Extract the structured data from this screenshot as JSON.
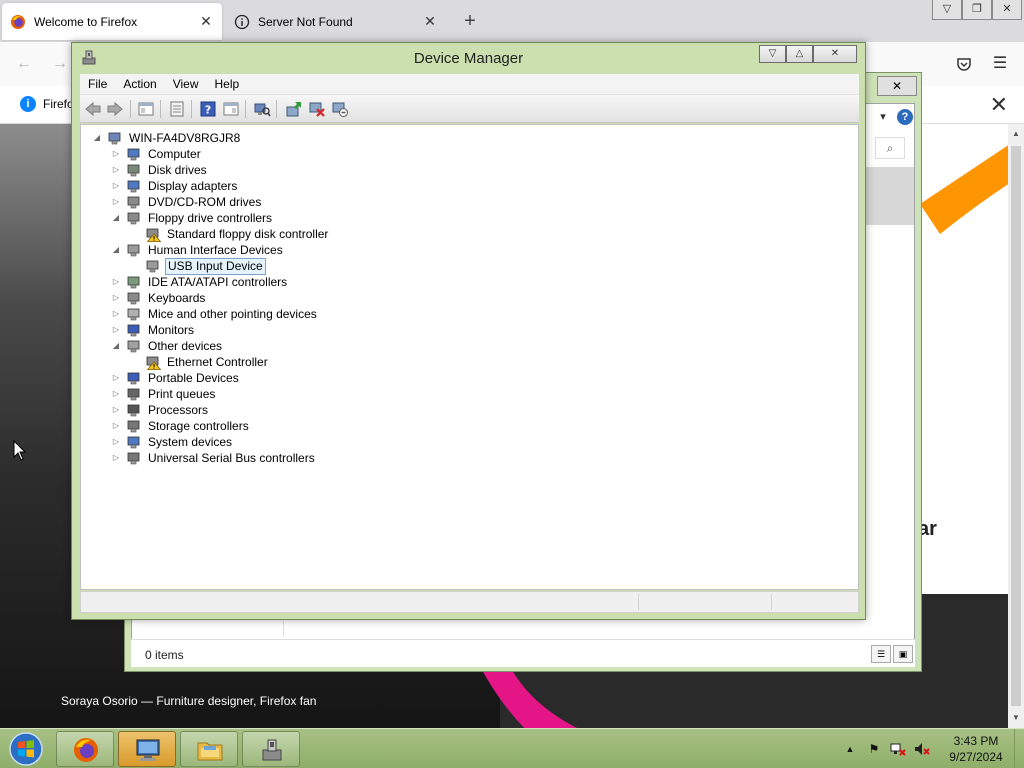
{
  "browser": {
    "tabs": [
      {
        "title": "Welcome to Firefox",
        "active": true,
        "icon": "firefox-icon"
      },
      {
        "title": "Server Not Found",
        "active": false,
        "icon": "info-circle-icon"
      }
    ],
    "notification": {
      "text": "Firefo",
      "icon": "info-icon"
    },
    "page": {
      "heading_fragment": "ar",
      "credit": "Soraya Osorio — Furniture designer, Firefox fan"
    },
    "accent_colors": {
      "tab_bar": "#dbdbde",
      "orange": "#ff9500",
      "pink": "#e31587"
    }
  },
  "background_window": {
    "status_text": "0 items"
  },
  "device_manager": {
    "title": "Device Manager",
    "menu": [
      "File",
      "Action",
      "View",
      "Help"
    ],
    "toolbar": [
      "back-icon",
      "forward-icon",
      "show-hide-console-tree-icon",
      "properties-icon",
      "help-icon",
      "action-pane-icon",
      "scan-hardware-icon",
      "update-driver-icon",
      "disable-device-icon",
      "uninstall-device-icon"
    ],
    "tree": [
      {
        "label": "WIN-FA4DV8RGJR8",
        "level": 0,
        "expanded": true,
        "icon": "computer-root-icon"
      },
      {
        "label": "Computer",
        "level": 1,
        "expanded": false,
        "icon": "computer-icon"
      },
      {
        "label": "Disk drives",
        "level": 1,
        "expanded": false,
        "icon": "disk-drive-icon"
      },
      {
        "label": "Display adapters",
        "level": 1,
        "expanded": false,
        "icon": "display-adapter-icon"
      },
      {
        "label": "DVD/CD-ROM drives",
        "level": 1,
        "expanded": false,
        "icon": "dvd-drive-icon"
      },
      {
        "label": "Floppy drive controllers",
        "level": 1,
        "expanded": true,
        "icon": "floppy-controller-icon"
      },
      {
        "label": "Standard floppy disk controller",
        "level": 2,
        "icon": "warning-device-icon"
      },
      {
        "label": "Human Interface Devices",
        "level": 1,
        "expanded": true,
        "icon": "hid-icon"
      },
      {
        "label": "USB Input Device",
        "level": 2,
        "selected": true,
        "icon": "hid-device-icon"
      },
      {
        "label": "IDE ATA/ATAPI controllers",
        "level": 1,
        "expanded": false,
        "icon": "ide-controller-icon"
      },
      {
        "label": "Keyboards",
        "level": 1,
        "expanded": false,
        "icon": "keyboard-icon"
      },
      {
        "label": "Mice and other pointing devices",
        "level": 1,
        "expanded": false,
        "icon": "mouse-icon"
      },
      {
        "label": "Monitors",
        "level": 1,
        "expanded": false,
        "icon": "monitor-icon"
      },
      {
        "label": "Other devices",
        "level": 1,
        "expanded": true,
        "icon": "other-devices-icon"
      },
      {
        "label": "Ethernet Controller",
        "level": 2,
        "icon": "warning-device-icon"
      },
      {
        "label": "Portable Devices",
        "level": 1,
        "expanded": false,
        "icon": "portable-device-icon"
      },
      {
        "label": "Print queues",
        "level": 1,
        "expanded": false,
        "icon": "printer-icon"
      },
      {
        "label": "Processors",
        "level": 1,
        "expanded": false,
        "icon": "processor-icon"
      },
      {
        "label": "Storage controllers",
        "level": 1,
        "expanded": false,
        "icon": "storage-controller-icon"
      },
      {
        "label": "System devices",
        "level": 1,
        "expanded": false,
        "icon": "system-device-icon"
      },
      {
        "label": "Universal Serial Bus controllers",
        "level": 1,
        "expanded": false,
        "icon": "usb-icon"
      }
    ]
  },
  "taskbar": {
    "apps": [
      "firefox-icon",
      "device-manager-icon",
      "file-explorer-icon",
      "control-panel-icon"
    ],
    "active_app": "device-manager-icon",
    "tray_icons": [
      "show-hidden-icons-icon",
      "action-center-flag-icon",
      "network-error-icon",
      "volume-muted-icon"
    ],
    "clock": {
      "time": "3:43 PM",
      "date": "9/27/2024"
    }
  }
}
